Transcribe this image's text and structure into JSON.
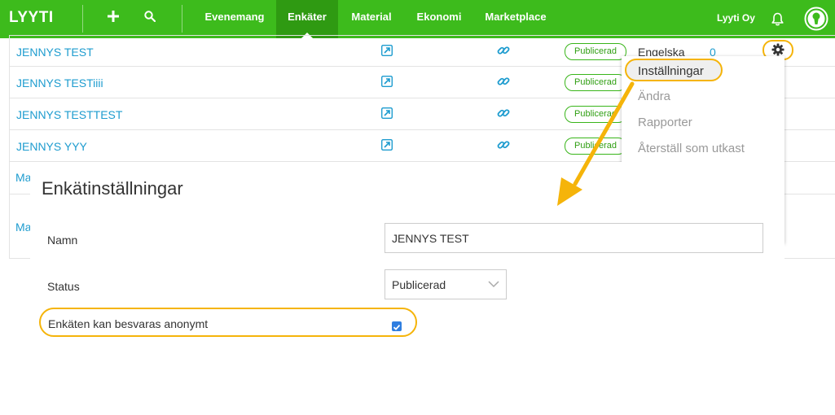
{
  "nav": {
    "logo": "LYYTI",
    "add_icon": "plus-icon",
    "search_icon": "search-icon",
    "items": [
      {
        "label": "Evenemang",
        "active": false
      },
      {
        "label": "Enkäter",
        "active": true
      },
      {
        "label": "Material",
        "active": false
      },
      {
        "label": "Ekonomi",
        "active": false
      },
      {
        "label": "Marketplace",
        "active": false
      }
    ],
    "org": "Lyyti Oy",
    "bell_icon": "bell-icon",
    "avatar_icon": "user-avatar-icon"
  },
  "table": {
    "rows": [
      {
        "name": "JENNYS TEST",
        "status": "Publicerad",
        "language": "Engelska",
        "count": "0"
      },
      {
        "name": "JENNYS TESTiiii",
        "status": "Publicerad"
      },
      {
        "name": "JENNYS TESTTEST",
        "status": "Publicerad"
      },
      {
        "name": "JENNYS YYY",
        "status": "Publicerad"
      }
    ],
    "partial_rows": [
      "Ma",
      "Ma"
    ]
  },
  "menu": {
    "items": [
      {
        "label": "Inställningar",
        "highlighted": true
      },
      {
        "label": "Ändra"
      },
      {
        "label": "Rapporter"
      },
      {
        "label": "Återställ som utkast"
      }
    ]
  },
  "dialog": {
    "title": "Enkätinställningar",
    "name_label": "Namn",
    "name_value": "JENNYS TEST",
    "status_label": "Status",
    "status_value": "Publicerad",
    "anonymous_label": "Enkäten kan besvaras anonymt",
    "anonymous_checked": true
  },
  "colors": {
    "brand_green": "#3dbb1c",
    "active_tab": "#2f9a12",
    "link_blue": "#1e9ccf",
    "highlight_orange": "#f5b40a",
    "checkbox_blue": "#2f7ee0"
  }
}
